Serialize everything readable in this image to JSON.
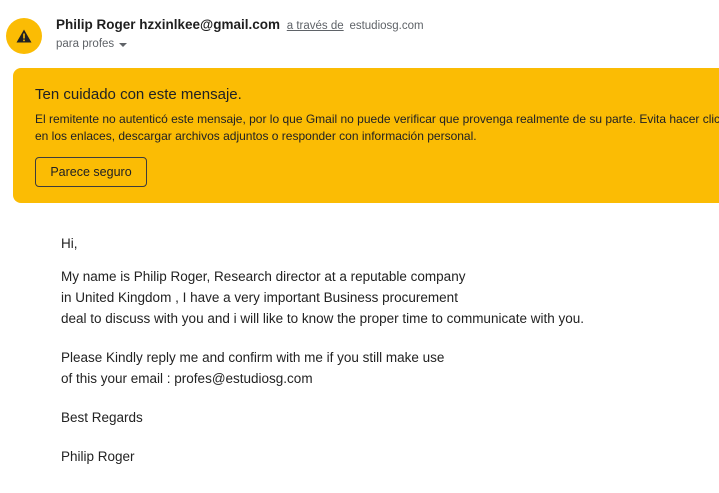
{
  "header": {
    "sender_name": "Philip Roger",
    "sender_email": "hzxinlkee@gmail.com",
    "via_label": "a través de",
    "via_domain": "estudiosg.com",
    "recipient": "para profes",
    "avatar_icon": "warning-triangle-icon",
    "avatar_color": "#fbbc04"
  },
  "warning": {
    "title": "Ten cuidado con este mensaje.",
    "body": "El remitente no autenticó este mensaje, por lo que Gmail no puede verificar que provenga realmente de su parte. Evita hacer clic en los enlaces, descargar archivos adjuntos o responder con información personal.",
    "button_label": "Parece seguro",
    "background_color": "#fbbc04"
  },
  "message": {
    "greeting": "Hi,",
    "paragraph1": [
      "My name is Philip Roger, Research director at a reputable company",
      "in United Kingdom , I have a very important Business procurement",
      "deal to discuss with you and i will like to know the proper time to communicate with you."
    ],
    "paragraph2": [
      "Please Kindly reply me and confirm with me if you still make use",
      "of this your email :  profes@estudiosg.com"
    ],
    "closing": "Best Regards",
    "signature": "Philip Roger"
  }
}
